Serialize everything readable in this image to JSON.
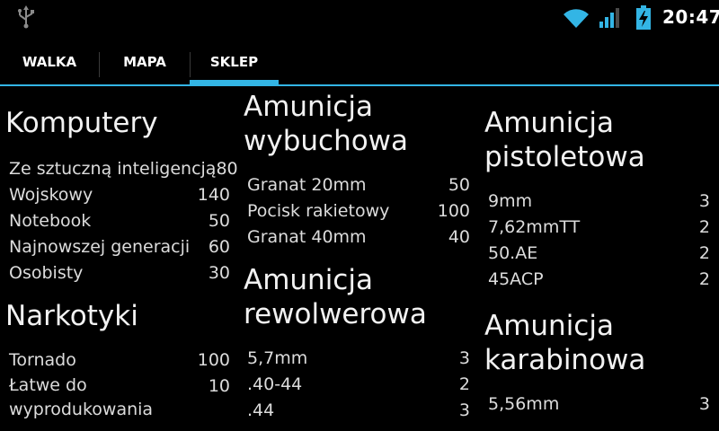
{
  "status_bar": {
    "time": "20:47",
    "icons": [
      "usb-icon",
      "wifi-icon",
      "signal-icon",
      "battery-charging-icon"
    ],
    "accent_color": "#33b5e5"
  },
  "tabs": [
    {
      "label": "WALKA",
      "active": false
    },
    {
      "label": "MAPA",
      "active": false
    },
    {
      "label": "SKLEP",
      "active": true
    }
  ],
  "sections": {
    "komputery": {
      "title": "Komputery",
      "items": [
        {
          "name": "Ze sztuczną inteligencją",
          "price": "80"
        },
        {
          "name": "Wojskowy",
          "price": "140"
        },
        {
          "name": "Notebook",
          "price": "50"
        },
        {
          "name": "Najnowszej generacji",
          "price": "60"
        },
        {
          "name": "Osobisty",
          "price": "30"
        }
      ]
    },
    "narkotyki": {
      "title": "Narkotyki",
      "items": [
        {
          "name": "Tornado",
          "price": "100"
        },
        {
          "name": "Łatwe do wyprodukowania",
          "price": "10"
        }
      ]
    },
    "wybuchowa": {
      "title": "Amunicja wybuchowa",
      "items": [
        {
          "name": "Granat 20mm",
          "price": "50"
        },
        {
          "name": "Pocisk rakietowy",
          "price": "100"
        },
        {
          "name": "Granat 40mm",
          "price": "40"
        }
      ]
    },
    "rewolwerowa": {
      "title": "Amunicja rewolwerowa",
      "items": [
        {
          "name": "5,7mm",
          "price": "3"
        },
        {
          "name": ".40-44",
          "price": "2"
        },
        {
          "name": ".44",
          "price": "3"
        }
      ]
    },
    "pistoletowa": {
      "title": "Amunicja pistoletowa",
      "items": [
        {
          "name": "9mm",
          "price": "3"
        },
        {
          "name": "7,62mmTT",
          "price": "2"
        },
        {
          "name": "50.AE",
          "price": "2"
        },
        {
          "name": "45ACP",
          "price": "2"
        }
      ]
    },
    "karabinowa": {
      "title": "Amunicja karabinowa",
      "items": [
        {
          "name": "5,56mm",
          "price": "3"
        }
      ]
    }
  }
}
